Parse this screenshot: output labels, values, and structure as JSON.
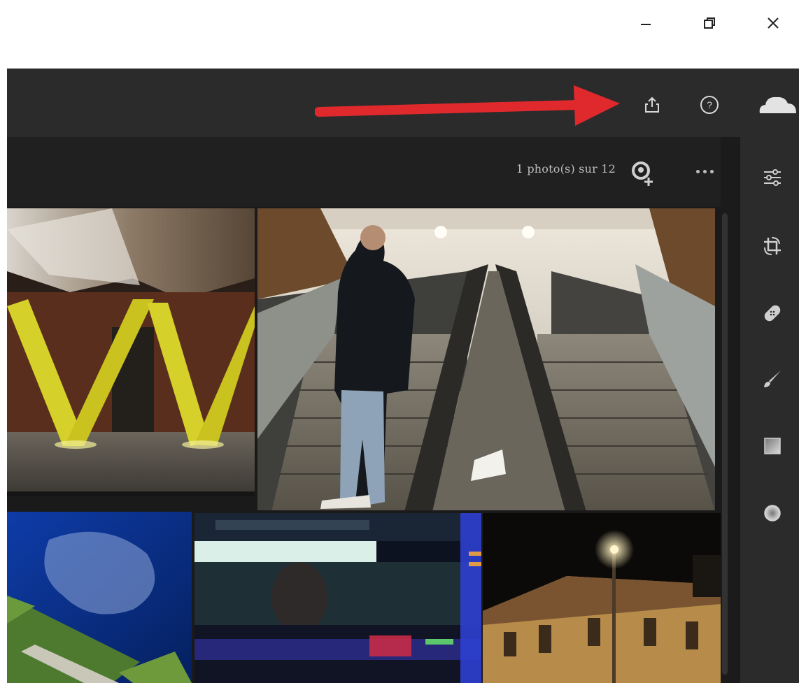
{
  "window": {
    "minimize_label": "–",
    "maximize_label": "restore",
    "close_label": "✕"
  },
  "header": {
    "icons": [
      "share-icon",
      "help-icon",
      "cloud-icon"
    ],
    "annotation": "red-arrow"
  },
  "toolbar": {
    "count_text": "1 photo(s) sur 12",
    "icons": [
      "add-people-icon",
      "more-icon"
    ]
  },
  "rail": {
    "tools": [
      "edit-sliders-icon",
      "crop-icon",
      "healing-icon",
      "brush-icon",
      "linear-gradient-icon",
      "radial-gradient-icon"
    ]
  },
  "grid": {
    "photos": [
      {
        "name": "yellow-v-pillars"
      },
      {
        "name": "man-on-escalator"
      },
      {
        "name": "blue-night-grass"
      },
      {
        "name": "blurred-train"
      },
      {
        "name": "street-lamp-building"
      }
    ]
  },
  "colors": {
    "accent_arrow": "#e0292c",
    "header_bg": "#2b2b2b",
    "toolbar_bg": "#202020",
    "icon": "#cfcfcf"
  }
}
